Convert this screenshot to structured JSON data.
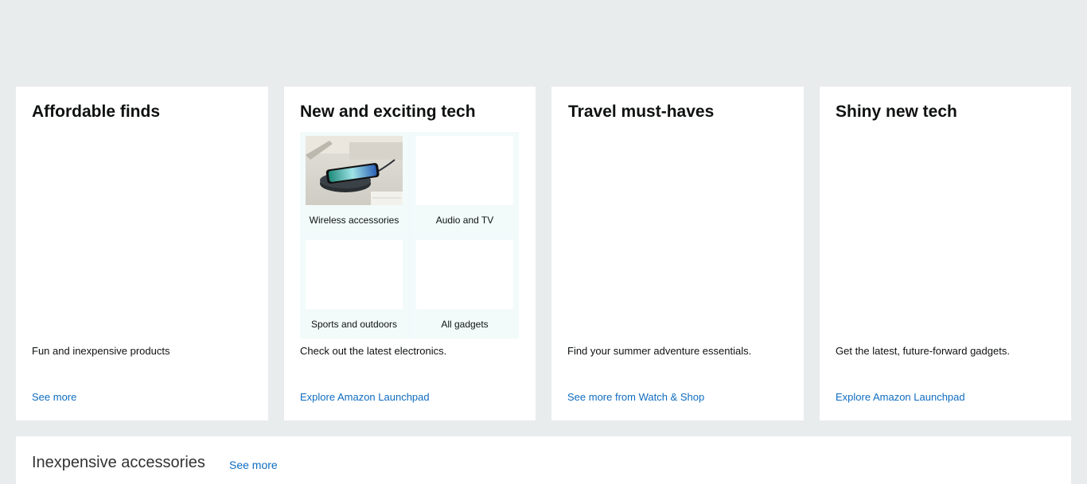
{
  "cards": [
    {
      "title": "Affordable finds",
      "description": "Fun and inexpensive products",
      "link": "See more"
    },
    {
      "title": "New and exciting tech",
      "description": "Check out the latest electronics.",
      "link": "Explore Amazon Launchpad",
      "tiles": [
        {
          "label": "Wireless accessories",
          "image": "wireless-charger-phone-image"
        },
        {
          "label": "Audio and TV"
        },
        {
          "label": "Sports and outdoors"
        },
        {
          "label": "All gadgets"
        }
      ]
    },
    {
      "title": "Travel must-haves",
      "description": "Find your summer adventure essentials.",
      "link": "See more from Watch & Shop"
    },
    {
      "title": "Shiny new tech",
      "description": "Get the latest, future-forward gadgets.",
      "link": "Explore Amazon Launchpad"
    }
  ],
  "row": {
    "title": "Inexpensive accessories",
    "link": "See more"
  },
  "colors": {
    "page_background": "#e9ecec",
    "link": "#0f6cbf",
    "tile_background": "#f1fafa"
  }
}
